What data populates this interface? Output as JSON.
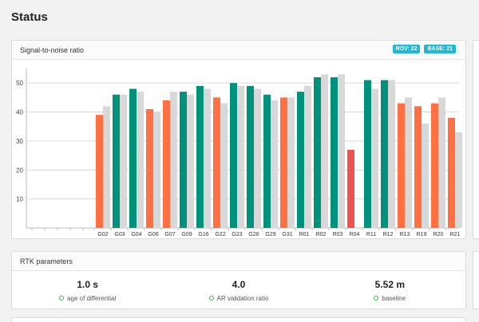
{
  "page_title": "Status",
  "snr": {
    "title": "Signal-to-noise ratio",
    "badges": [
      {
        "label": "ROV: 22"
      },
      {
        "label": "BASE: 21"
      }
    ]
  },
  "chart_data": {
    "type": "bar",
    "title": "Signal-to-noise ratio",
    "ylim": [
      0,
      55
    ],
    "yticks": [
      10,
      20,
      30,
      40,
      50
    ],
    "grid": true,
    "categories": [
      "G02",
      "G03",
      "G04",
      "G06",
      "G07",
      "G09",
      "G16",
      "G22",
      "G23",
      "G26",
      "G29",
      "G31",
      "R01",
      "R02",
      "R03",
      "R04",
      "R11",
      "R12",
      "R13",
      "R19",
      "R20",
      "R21"
    ],
    "series": [
      {
        "name": "ROV: 22",
        "values": [
          39,
          46,
          48,
          41,
          44,
          47,
          49,
          45,
          50,
          49,
          46,
          45,
          47,
          52,
          52,
          27,
          51,
          51,
          43,
          42,
          43,
          38
        ]
      },
      {
        "name": "BASE: 21",
        "values": [
          42,
          46,
          47,
          40,
          47,
          46,
          48,
          43,
          49,
          48,
          44,
          45,
          49,
          53,
          53,
          null,
          48,
          51,
          45,
          36,
          45,
          33
        ]
      }
    ],
    "rover_colors": [
      "#ff7043",
      "#00917c",
      "#00917c",
      "#ff7043",
      "#ff7043",
      "#00917c",
      "#00917c",
      "#ff7043",
      "#00917c",
      "#00917c",
      "#00917c",
      "#ff7043",
      "#00917c",
      "#00917c",
      "#00917c",
      "#ef5350",
      "#00917c",
      "#00917c",
      "#ff7043",
      "#ff7043",
      "#ff7043",
      "#ff7043"
    ],
    "base_color": "#d8d8d8"
  },
  "rtk": {
    "title": "RTK parameters",
    "items": [
      {
        "value": "1.0 s",
        "label": "age of differential"
      },
      {
        "value": "4.0",
        "label": "AR validation ratio"
      },
      {
        "value": "5.52 m",
        "label": "baseline"
      }
    ]
  }
}
